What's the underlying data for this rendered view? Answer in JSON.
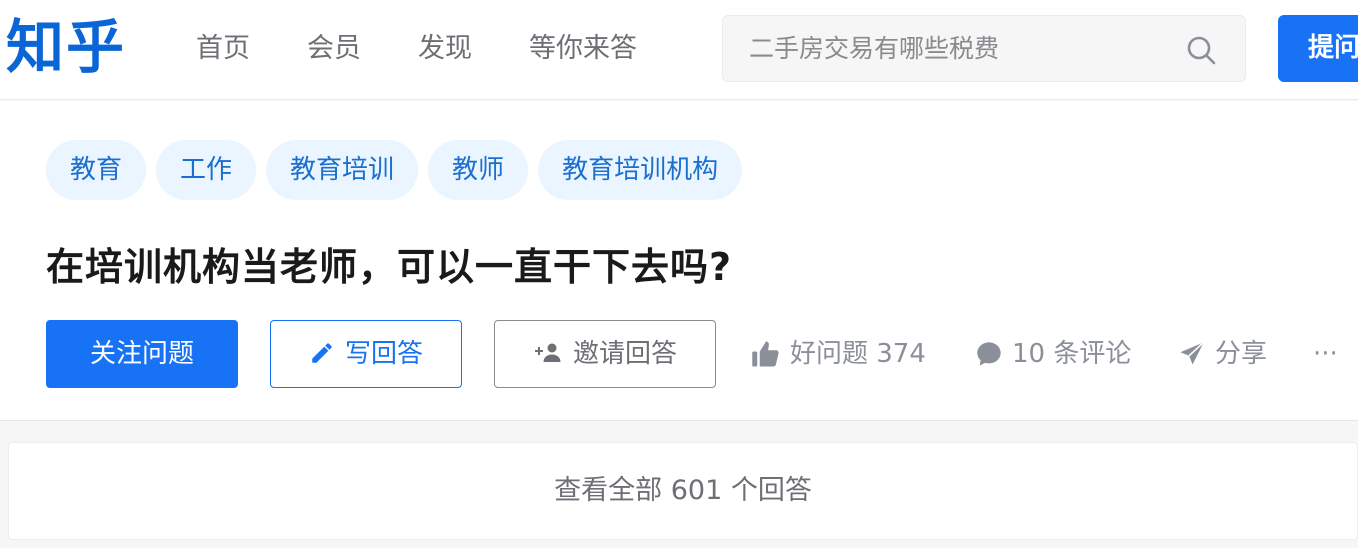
{
  "header": {
    "logo": "知乎",
    "nav": [
      "首页",
      "会员",
      "发现",
      "等你来答"
    ],
    "search_placeholder": "二手房交易有哪些税费",
    "ask_label": "提问"
  },
  "question": {
    "tags": [
      "教育",
      "工作",
      "教育培训",
      "教师",
      "教育培训机构"
    ],
    "title": "在培训机构当老师，可以一直干下去吗?",
    "follow_label": "关注问题",
    "write_label": "写回答",
    "invite_label": "邀请回答",
    "good_question_label": "好问题 374",
    "comments_label": "10 条评论",
    "share_label": "分享",
    "more_label": "···"
  },
  "view_all_label": "查看全部 601 个回答",
  "colors": {
    "brand": "#1772f6",
    "tag_bg": "#ebf5ff",
    "tag_text": "#1b6fd1"
  }
}
